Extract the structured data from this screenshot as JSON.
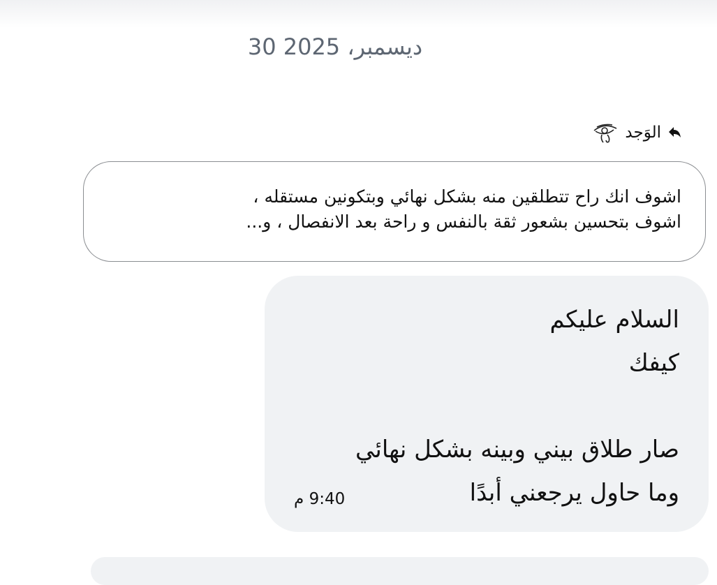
{
  "date_separator": "30 ديسمبر، 2025",
  "reply": {
    "name": "الوَجد",
    "reply_icon": "reply-arrow-icon",
    "name_icon": "eye-of-horus-icon"
  },
  "quoted_message": {
    "lines": [
      "اشوف انك راح تتطلقين منه بشكل نهائي وبتكونين مستقله ،",
      "اشوف بتحسين بشعور ثقة بالنفس و راحة بعد الانفصال ، و..."
    ]
  },
  "message": {
    "lines": [
      "السلام عليكم",
      "كيفك",
      "",
      "صار طلاق بيني وبينه  بشكل نهائي",
      "وما حاول يرجعني أبدًا"
    ],
    "time": "9:40 م"
  },
  "colors": {
    "bubble_background": "#f0f2f4",
    "quote_border": "#8a8d91",
    "date_text": "#5d6672"
  }
}
